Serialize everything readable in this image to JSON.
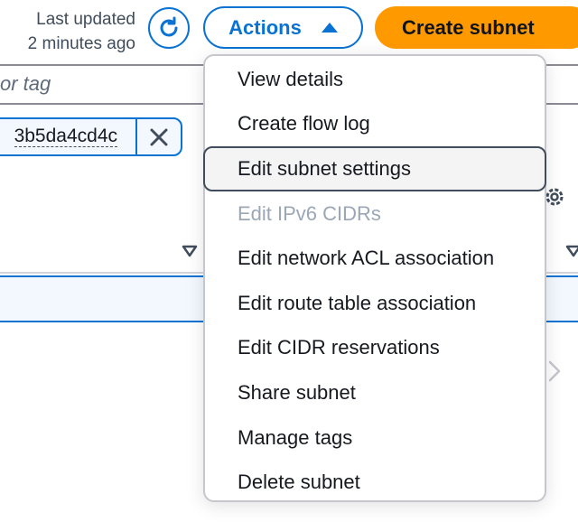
{
  "header": {
    "last_updated_line1": "Last updated",
    "last_updated_line2": "2 minutes ago",
    "refresh_icon": "refresh-icon",
    "actions_label": "Actions",
    "create_subnet_label": "Create subnet"
  },
  "filter": {
    "placeholder_fragment": "or tag",
    "token_value": "3b5da4cd4c",
    "token_close_icon": "close-icon"
  },
  "table": {
    "settings_icon": "gear-icon",
    "sort_icon": "sort-down-icon"
  },
  "actions_menu": {
    "items": [
      {
        "label": "View details",
        "state": "enabled"
      },
      {
        "label": "Create flow log",
        "state": "enabled"
      },
      {
        "label": "Edit subnet settings",
        "state": "highlighted"
      },
      {
        "label": "Edit IPv6 CIDRs",
        "state": "disabled"
      },
      {
        "label": "Edit network ACL association",
        "state": "enabled"
      },
      {
        "label": "Edit route table association",
        "state": "enabled"
      },
      {
        "label": "Edit CIDR reservations",
        "state": "enabled"
      },
      {
        "label": "Share subnet",
        "state": "enabled"
      },
      {
        "label": "Manage tags",
        "state": "enabled"
      },
      {
        "label": "Delete subnet",
        "state": "enabled"
      }
    ]
  },
  "colors": {
    "accent": "#0972d3",
    "primary_button": "#ff9900",
    "disabled_text": "#9ba7b6",
    "text": "#16191f"
  }
}
